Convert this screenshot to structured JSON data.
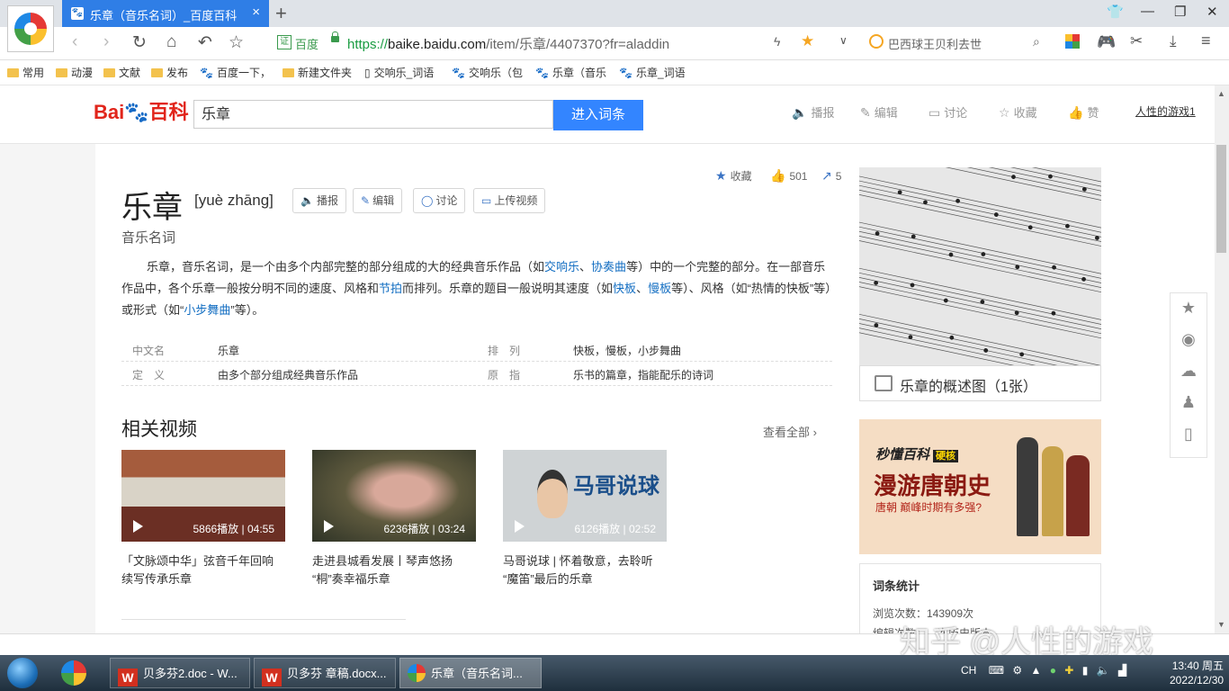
{
  "browser": {
    "tab_title": "乐章（音乐名词）_百度百科",
    "address": {
      "ev_label": "百度",
      "scheme": "https://",
      "host": "baike.baidu.com",
      "path": "/item/乐章/4407370?fr=aladdin"
    },
    "search_value": "巴西球王贝利去世",
    "bookmarks": [
      "常用",
      "动漫",
      "文献",
      "发布",
      "百度一下，",
      "新建文件夹",
      "交响乐_词语",
      "交响乐（包",
      "乐章（音乐",
      "乐章_词语"
    ]
  },
  "baike": {
    "logo_text": "Bai百科",
    "search_value": "乐章",
    "enter_button": "进入词条",
    "header_actions": [
      "播报",
      "编辑",
      "讨论",
      "收藏",
      "赞"
    ],
    "user_link": "人性的游戏1",
    "title": "乐章",
    "pinyin": "[yuè zhāng]",
    "title_buttons": [
      "播报",
      "编辑",
      "讨论",
      "上传视频"
    ],
    "subtitle": "音乐名词",
    "collect_label": "收藏",
    "likes": "501",
    "shares": "5",
    "summary": {
      "p1": "乐章，音乐名词，是一个由多个内部完整的部分组成的大的经典音乐作品（如",
      "link1": "交响乐",
      "p2": "、",
      "link2": "协奏曲",
      "p3": "等）中的一个完整的部分。在一部音乐作品中，各个乐章一般按分明不同的速度、风格和",
      "link3": "节拍",
      "p4": "而排列。乐章的题目一般说明其速度（如",
      "link4": "快板",
      "p5": "、",
      "link5": "慢板",
      "p6": "等）、风格（如“热情的快板”等）或形式（如“",
      "link6": "小步舞曲",
      "p7": "”等）。"
    },
    "infobox": [
      {
        "k1": "中文名",
        "v1": "乐章",
        "k2": "排　列",
        "v2": "快板，慢板，小步舞曲"
      },
      {
        "k1": "定　义",
        "v1": "由多个部分组成经典音乐作品",
        "k2": "原　指",
        "v2": "乐书的篇章，指能配乐的诗词"
      }
    ],
    "videos_heading": "相关视频",
    "videos_more": "查看全部",
    "videos": [
      {
        "meta": "5866播放 | 04:55",
        "caption": "「文脉颂中华」弦音千年回响 续写传承乐章",
        "color": "#8a5a44"
      },
      {
        "meta": "6236播放 | 03:24",
        "caption": "走进县城看发展丨琴声悠扬 “桐”奏幸福乐章",
        "color": "#6d6b55"
      },
      {
        "meta": "6126播放 | 02:52",
        "caption": "马哥说球 | 怀着敬意，去聆听 “魔笛”最后的乐章",
        "color": "#c9cdcf"
      }
    ],
    "video3_overlay": "马哥说球",
    "overview_caption": "乐章的概述图（1张）",
    "ad": {
      "line1": "秒懂百科",
      "tag": "硬核",
      "line2": "漫游唐朝史",
      "line3": "唐朝 巅峰时期有多强?"
    },
    "stats": {
      "heading": "词条统计",
      "views": "浏览次数：143909次",
      "edits": "编辑次数：…次历史版本"
    }
  },
  "watermark": "知乎 @人性的游戏",
  "taskbar": {
    "apps": [
      "贝多芬2.doc - W...",
      "贝多芬 章稿.docx...",
      "乐章（音乐名词..."
    ],
    "ime": "CH",
    "time": "13:40 周五",
    "date": "2022/12/30"
  },
  "colors": {
    "accent": "#3385ff",
    "tab_active": "#2f7ee6",
    "link": "#136ec2"
  }
}
